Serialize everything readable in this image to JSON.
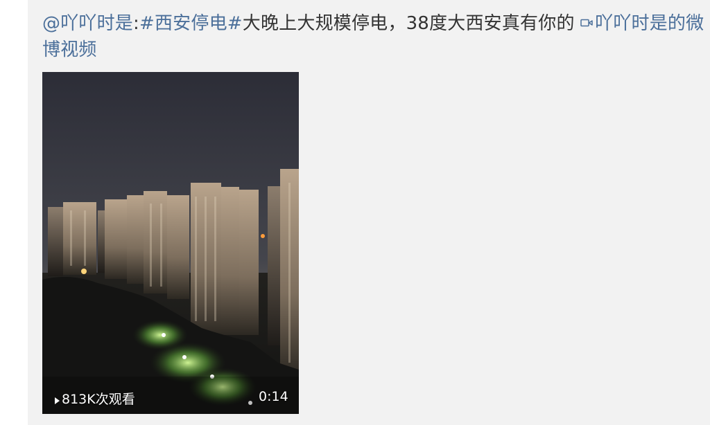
{
  "post": {
    "mention": "@吖吖时是",
    "colon": ":",
    "hashtag": "#西安停电#",
    "body": "大晚上大规模停电，38度大西安真有你的",
    "video_link_label": "吖吖时是的微博视频",
    "video_link_icon": "video-camera-icon"
  },
  "video": {
    "views": "813K次观看",
    "duration": "0:14"
  },
  "colors": {
    "card_background": "#f2f2f2",
    "text": "#333333",
    "link": "#4b6f9a"
  }
}
